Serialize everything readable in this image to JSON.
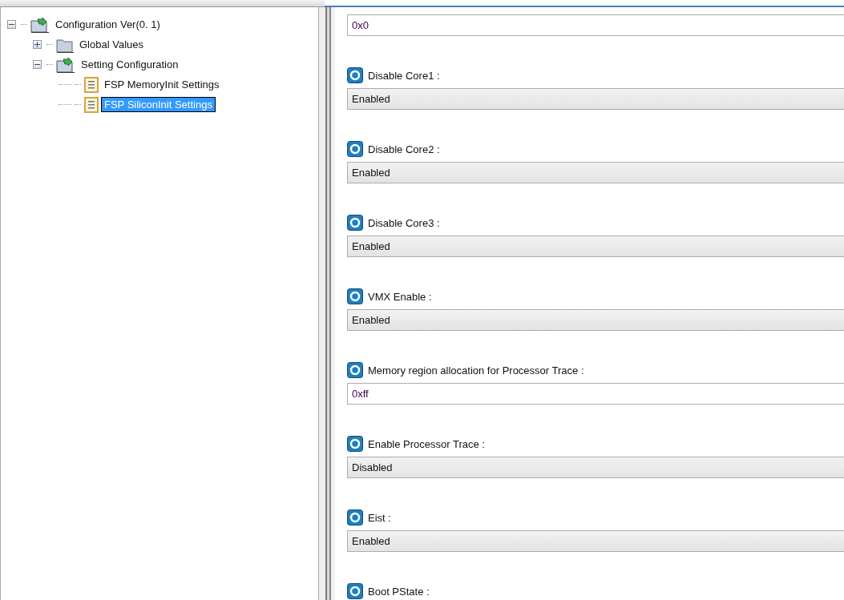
{
  "tree": [
    {
      "label": "Configuration Ver(0. 1)",
      "expanded": true,
      "selected": false,
      "children": [
        {
          "label": "Global Values",
          "expanded": false,
          "selected": false
        },
        {
          "label": "Setting Configuration",
          "expanded": true,
          "selected": false,
          "children": [
            {
              "label": "FSP MemoryInit Settings",
              "selected": false
            },
            {
              "label": "FSP SiliconInit Settings",
              "selected": true
            }
          ]
        }
      ]
    }
  ],
  "settings": [
    {
      "field": {
        "kind": "text",
        "value": "0x0"
      }
    },
    {
      "label": "Disable Core1 :",
      "field": {
        "kind": "select",
        "value": "Enabled"
      }
    },
    {
      "label": "Disable Core2 :",
      "field": {
        "kind": "select",
        "value": "Enabled"
      }
    },
    {
      "label": "Disable Core3 :",
      "field": {
        "kind": "select",
        "value": "Enabled"
      }
    },
    {
      "label": "VMX Enable :",
      "field": {
        "kind": "select",
        "value": "Enabled"
      }
    },
    {
      "label": "Memory region allocation for Processor Trace :",
      "field": {
        "kind": "text",
        "value": "0xff"
      }
    },
    {
      "label": "Enable Processor Trace :",
      "field": {
        "kind": "select",
        "value": "Disabled"
      }
    },
    {
      "label": "Eist :",
      "field": {
        "kind": "select",
        "value": "Enabled"
      }
    },
    {
      "label": "Boot PState :"
    }
  ]
}
